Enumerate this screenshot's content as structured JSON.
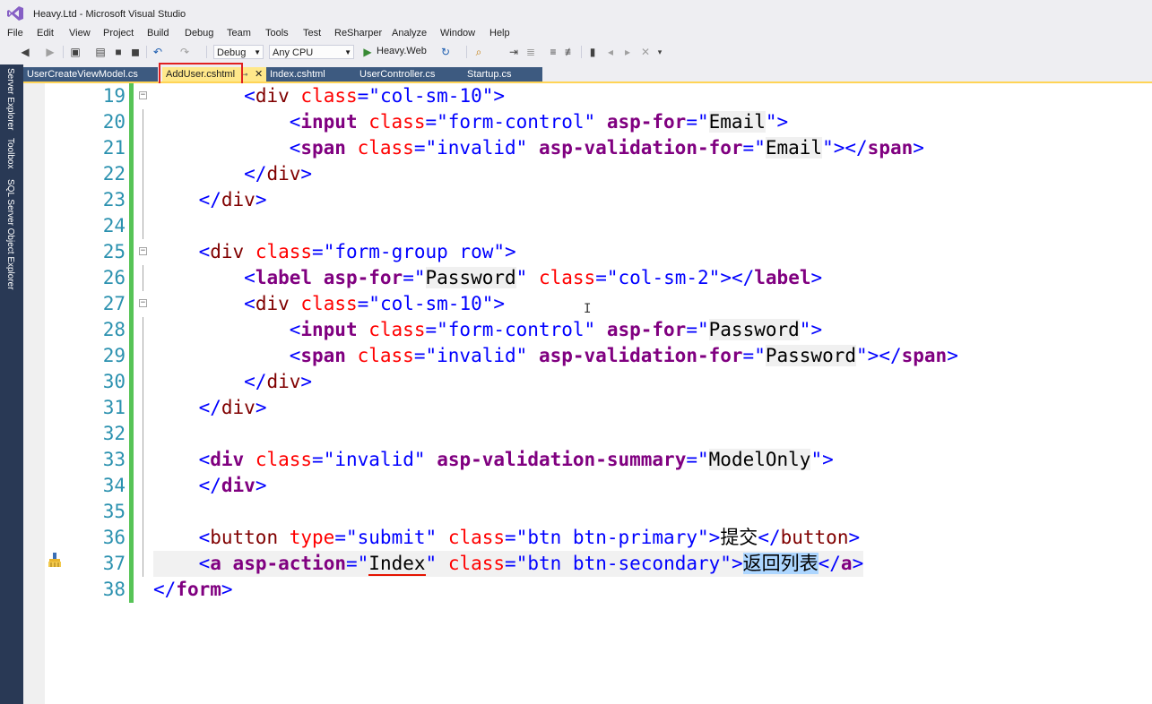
{
  "window": {
    "title": "Heavy.Ltd - Microsoft Visual Studio",
    "logo_icon": "visual-studio-logo-icon"
  },
  "menu": [
    "File",
    "Edit",
    "View",
    "Project",
    "Build",
    "Debug",
    "Team",
    "Tools",
    "Test",
    "ReSharper",
    "Analyze",
    "Window",
    "Help"
  ],
  "toolbar": {
    "config": "Debug",
    "platform": "Any CPU",
    "startup_project": "Heavy.Web"
  },
  "sidebar": [
    "Server Explorer",
    "Toolbox",
    "SQL Server Object Explorer"
  ],
  "tabs": [
    {
      "label": "UserCreateViewModel.cs",
      "active": false
    },
    {
      "label": "AddUser.cshtml",
      "active": true
    },
    {
      "label": "Index.cshtml",
      "active": false
    },
    {
      "label": "UserController.cs",
      "active": false
    },
    {
      "label": "Startup.cs",
      "active": false
    }
  ],
  "colors": {
    "accent": "#ffd456",
    "highlight_box": "#e02020",
    "change_bar": "#57c457",
    "line_number": "#2b91af"
  },
  "editor": {
    "lines": [
      {
        "num": "19"
      },
      {
        "num": "20"
      },
      {
        "num": "21"
      },
      {
        "num": "22"
      },
      {
        "num": "23"
      },
      {
        "num": "24"
      },
      {
        "num": "25"
      },
      {
        "num": "26"
      },
      {
        "num": "27"
      },
      {
        "num": "28"
      },
      {
        "num": "29"
      },
      {
        "num": "30"
      },
      {
        "num": "31"
      },
      {
        "num": "32"
      },
      {
        "num": "33"
      },
      {
        "num": "34"
      },
      {
        "num": "35"
      },
      {
        "num": "36"
      },
      {
        "num": "37"
      },
      {
        "num": "38"
      }
    ],
    "tokens": {
      "div": "div",
      "input": "input",
      "span": "span",
      "label": "label",
      "button": "button",
      "a": "a",
      "form": "form",
      "class": "class",
      "type": "type",
      "asp_for": "asp-for",
      "asp_vfor": "asp-validation-for",
      "asp_vsum": "asp-validation-summary",
      "asp_action": "asp-action",
      "col_sm_10": "col-sm-10",
      "form_control": "form-control",
      "invalid": "invalid",
      "form_group_row": "form-group row",
      "col_sm_2": "col-sm-2",
      "submit": "submit",
      "btn_primary": "btn btn-primary",
      "btn_secondary": "btn btn-secondary",
      "Email": "Email",
      "Password": "Password",
      "ModelOnly": "ModelOnly",
      "Index": "Index",
      "submit_text": "提交",
      "back_text": "返回列表"
    }
  }
}
